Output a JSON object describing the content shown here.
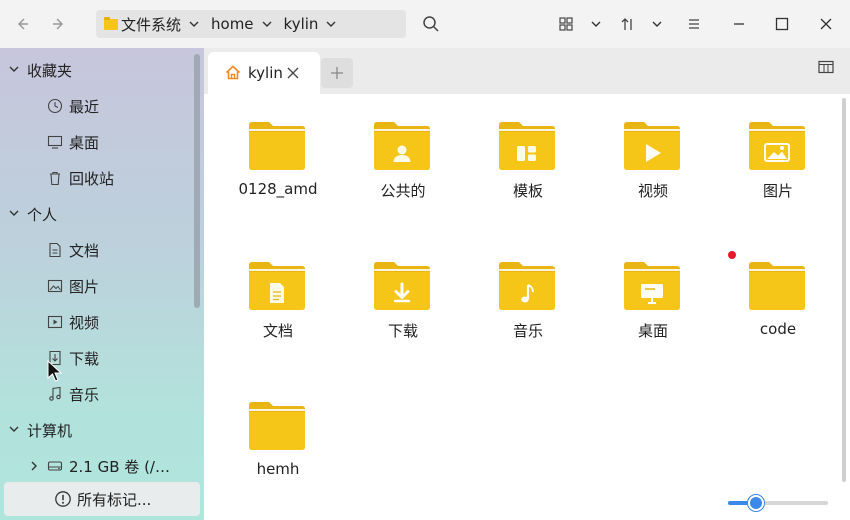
{
  "toolbar": {
    "breadcrumbs": [
      {
        "label": "文件系统",
        "icon": "folder-icon"
      },
      {
        "label": "home"
      },
      {
        "label": "kylin"
      }
    ],
    "icons": [
      "back-icon",
      "forward-icon",
      "search-icon",
      "grid-view-icon",
      "sort-icon",
      "menu-icon",
      "minimize-icon",
      "maximize-icon",
      "close-icon"
    ]
  },
  "sidebar": {
    "groups": [
      {
        "label": "收藏夹",
        "items": [
          {
            "label": "最近",
            "icon": "clock-icon"
          },
          {
            "label": "桌面",
            "icon": "monitor-icon"
          },
          {
            "label": "回收站",
            "icon": "trash-icon"
          }
        ]
      },
      {
        "label": "个人",
        "items": [
          {
            "label": "文档",
            "icon": "document-icon"
          },
          {
            "label": "图片",
            "icon": "picture-icon"
          },
          {
            "label": "视频",
            "icon": "video-icon"
          },
          {
            "label": "下载",
            "icon": "download-icon"
          },
          {
            "label": "音乐",
            "icon": "music-icon"
          }
        ]
      },
      {
        "label": "计算机",
        "items": [
          {
            "label": "2.1 GB 卷 (/…",
            "icon": "disk-icon"
          }
        ]
      }
    ],
    "marks_label": "所有标记..."
  },
  "tabs": [
    {
      "label": "kylin",
      "icon": "home-icon"
    }
  ],
  "files": [
    {
      "label": "0128_amd",
      "emblem": "none"
    },
    {
      "label": "公共的",
      "emblem": "person"
    },
    {
      "label": "模板",
      "emblem": "template"
    },
    {
      "label": "视频",
      "emblem": "play"
    },
    {
      "label": "图片",
      "emblem": "image"
    },
    {
      "label": "文档",
      "emblem": "doc"
    },
    {
      "label": "下载",
      "emblem": "download"
    },
    {
      "label": "音乐",
      "emblem": "music"
    },
    {
      "label": "桌面",
      "emblem": "desktop"
    },
    {
      "label": "code",
      "emblem": "none"
    },
    {
      "label": "hemh",
      "emblem": "none"
    }
  ],
  "zoom": {
    "level": 0.28
  },
  "colors": {
    "folder": "#f5c518",
    "folder_tab": "#e8b512",
    "accent": "#3b88e8",
    "notify": "#e8192c"
  }
}
